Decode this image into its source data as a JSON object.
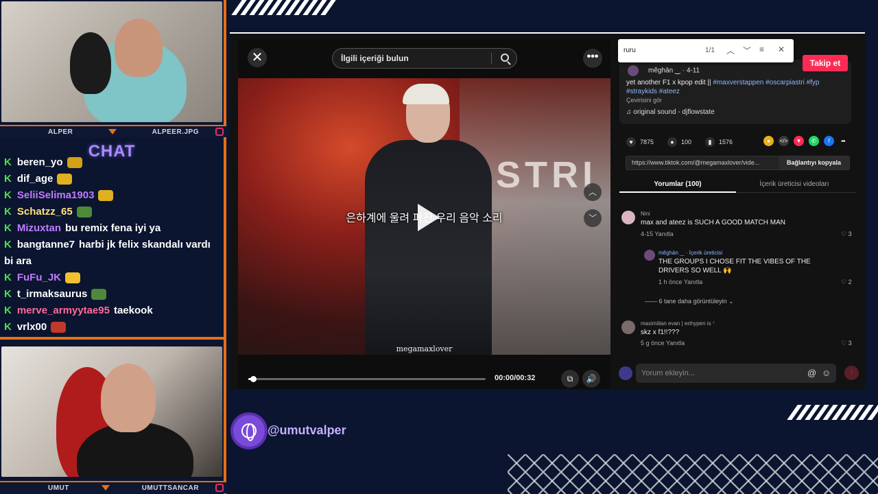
{
  "stream": {
    "cam_top_name_left": "ALPER",
    "cam_top_name_right": "ALPEER.JPG",
    "cam_bottom_name_left": "UMUT",
    "cam_bottom_name_right": "UMUTTSANCAR",
    "chat_title": "CHAT",
    "chat_messages": [
      {
        "user": "beren_yo",
        "text": "",
        "user_color": "#ffffff",
        "emote": "#d4a017"
      },
      {
        "user": "dif_age",
        "text": "",
        "user_color": "#ffffff",
        "emote": "#e0b020"
      },
      {
        "user": "SeliiSelima1903",
        "text": "",
        "user_color": "#c07bff",
        "emote": "#e0b020"
      },
      {
        "user": "Schatzz_65",
        "text": "",
        "user_color": "#ffe27a",
        "emote": "#4c8a3a"
      },
      {
        "user": "Mizuxtan",
        "text": "bu remix fena iyi ya",
        "user_color": "#c07bff",
        "emote": ""
      },
      {
        "user": "bangtanne7",
        "text": "harbi jk felix skandalı vardı bi ara",
        "user_color": "#ffffff",
        "emote": ""
      },
      {
        "user": "FuFu_JK",
        "text": "",
        "user_color": "#c07bff",
        "emote": "#f0c030"
      },
      {
        "user": "t_irmaksaurus",
        "text": "",
        "user_color": "#ffffff",
        "emote": "#4c8a3a"
      },
      {
        "user": "merve_armyytae95",
        "text": "taekook",
        "user_color": "#ff6a9a",
        "emote": ""
      },
      {
        "user": "vrlx00",
        "text": "",
        "user_color": "#ffffff",
        "emote": "#c0392b"
      }
    ],
    "handle": "@umutvalper"
  },
  "video": {
    "search_placeholder": "İlgili içeriği bulun",
    "subtitle": "은하계에 울려 퍼진 우리 음악 소리",
    "watermark": "megamaxlover",
    "bg_text": "ASTRI",
    "timecode": "00:00/00:32",
    "progress": 0.02,
    "close_glyph": "✕",
    "more_glyph": "•••",
    "up_glyph": "︿",
    "down_glyph": "﹀",
    "pip_glyph": "⧉",
    "volume_glyph": "🔊"
  },
  "findbar": {
    "query": "ruru",
    "count": "1/1"
  },
  "post": {
    "follow_label": "Takip et",
    "author": "mĕghān ‿ · 4-11",
    "caption": "yet another F1 x kpop edit ||",
    "hashtags": "#maxverstappen #oscarpiastri #fyp #straykids #ateez",
    "translate": "Çevirisini gör",
    "sound": "♫  original sound - djflowstate",
    "likes": "7875",
    "comments": "100",
    "saves": "1576",
    "link": "https://www.tiktok.com/@megamaxlover/vide...",
    "copy_label": "Bağlantıyı kopyala",
    "tab_comments": "Yorumlar (100)",
    "tab_creator": "İçerik üreticisi videoları"
  },
  "comments": [
    {
      "name": "Nini",
      "text": "max and ateez is SUCH A GOOD MATCH MAN",
      "meta": "4-15    Yanıtla",
      "likes": "♡ 3"
    },
    {
      "name": "mĕghān ‿ · İçerik üreticisi",
      "text": "THE GROUPS I CHOSE FIT THE VIBES OF THE DRIVERS SO WELL 🙌",
      "meta": "1 h önce    Yanıtla",
      "likes": "♡ 2"
    },
    {
      "name": "maximilian evan | enhypen is ⁷",
      "text": "skz x f1!!???",
      "meta": "5 g önce    Yanıtla",
      "likes": "♡ 3"
    }
  ],
  "more_replies": "—— 6 tane daha görüntüleyin ⌄",
  "comment_input_placeholder": "Yorum ekleyin...",
  "colors": {
    "accent_orange": "#e86f16",
    "tiktok_red": "#fe2c55",
    "chat_purple": "#a98bff"
  }
}
